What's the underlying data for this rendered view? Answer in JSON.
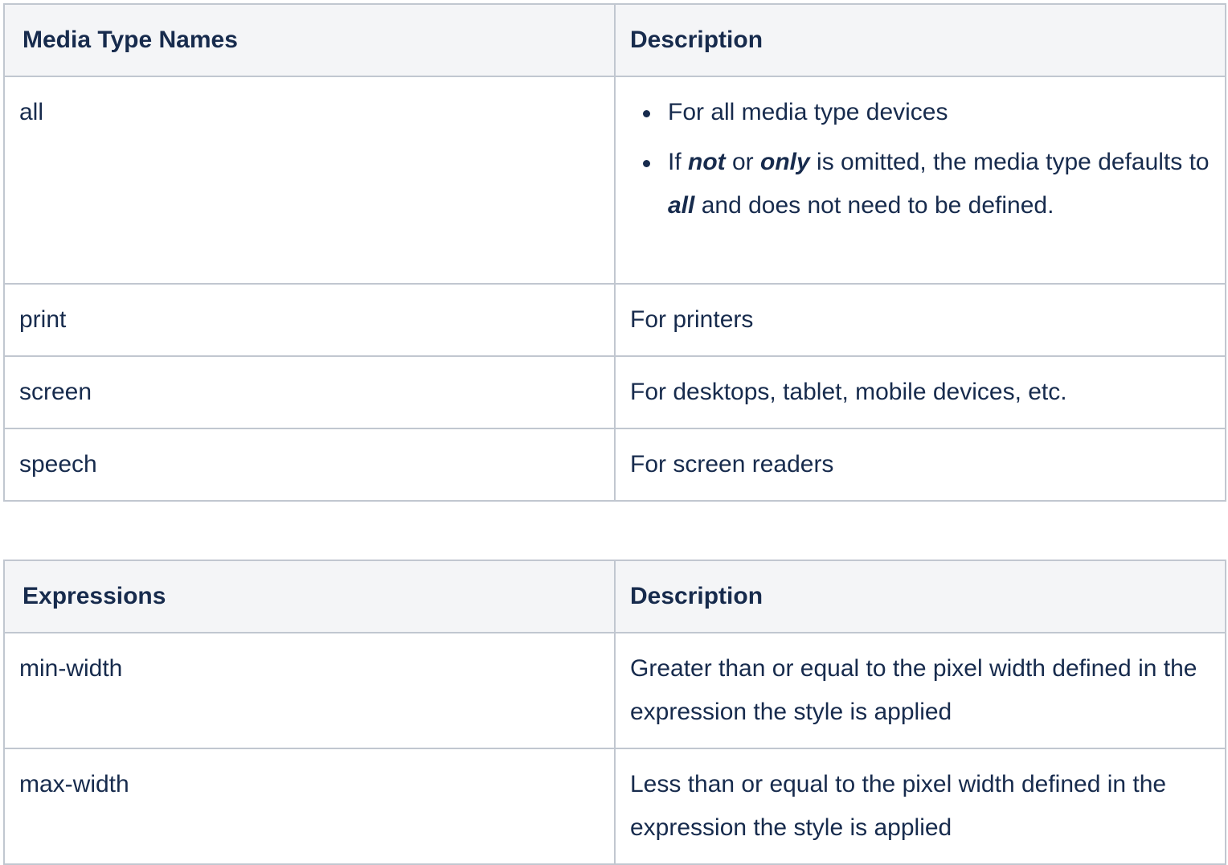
{
  "media_types_table": {
    "headers": [
      "Media Type Names",
      "Description"
    ],
    "rows": [
      {
        "name": "all",
        "bullets": [
          {
            "text": "For all media type devices"
          },
          {
            "parts": {
              "t1": "If ",
              "em1": "not",
              "t2": " or ",
              "em2": "only",
              "t3": " is omitted, the media type defaults to ",
              "em3": "all",
              "t4": " and does not need to be defined."
            }
          }
        ]
      },
      {
        "name": "print",
        "description": "For printers"
      },
      {
        "name": "screen",
        "description": "For desktops, tablet, mobile devices, etc."
      },
      {
        "name": "speech",
        "description": "For screen readers"
      }
    ]
  },
  "expressions_table": {
    "headers": [
      "Expressions",
      "Description"
    ],
    "rows": [
      {
        "name": "min-width",
        "description": "Greater than or equal to the pixel width defined in the expression the style is applied"
      },
      {
        "name": "max-width",
        "description": "Less than or equal to the pixel width defined in the expression the style is applied"
      }
    ]
  }
}
